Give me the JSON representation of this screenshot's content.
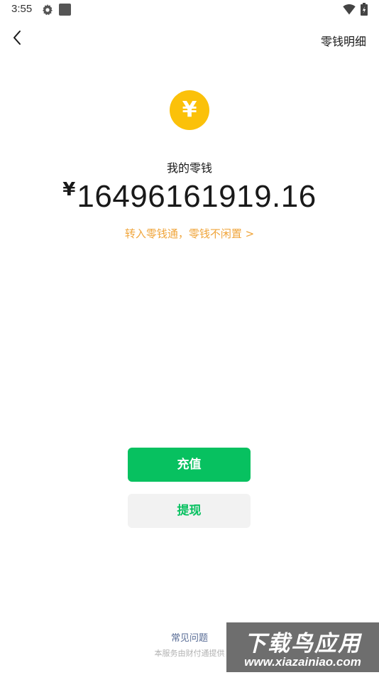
{
  "status_bar": {
    "time": "3:55",
    "icons": [
      "gear-icon",
      "square-icon",
      "wifi-icon",
      "battery-icon"
    ]
  },
  "header": {
    "back_icon": "chevron-left-icon",
    "details_label": "零钱明细"
  },
  "wallet": {
    "coin_icon": "yuan-coin-icon",
    "coin_symbol": "¥",
    "coin_color": "#fbc10a",
    "label": "我的零钱",
    "currency_symbol": "¥",
    "amount": "16496161919.16",
    "promo_text": "转入零钱通，零钱不闲置 >",
    "promo_color": "#f0a53b"
  },
  "actions": {
    "recharge_label": "充值",
    "withdraw_label": "提现",
    "primary_color": "#07c160"
  },
  "footer": {
    "faq_label": "常见问题",
    "service_note": "本服务由财付通提供"
  },
  "watermark": {
    "line1": "下载鸟应用",
    "line2": "www.xiazainiao.com"
  }
}
